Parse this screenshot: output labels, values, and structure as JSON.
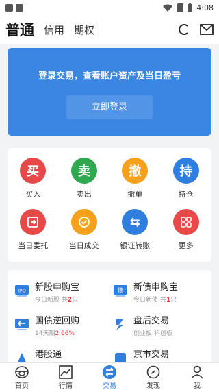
{
  "status": {
    "time": "4:08"
  },
  "nav": {
    "tabs": [
      "普通",
      "信用",
      "期权"
    ]
  },
  "banner": {
    "text": "登录交易，查看账户资产及当日盈亏",
    "login_button": "立即登录"
  },
  "actions": [
    {
      "glyph": "买",
      "label": "买入",
      "color": "#e84848"
    },
    {
      "glyph": "卖",
      "label": "卖出",
      "color": "#2fa84f"
    },
    {
      "glyph": "撤",
      "label": "撤单",
      "color": "#f7a11b"
    },
    {
      "glyph": "持",
      "label": "持仓",
      "color": "#2f7fe0"
    },
    {
      "glyph": "",
      "label": "当日委托",
      "color": "#e84848"
    },
    {
      "glyph": "",
      "label": "当日成交",
      "color": "#f7a11b"
    },
    {
      "glyph": "⇆",
      "label": "银证转账",
      "color": "#2f7fe0"
    },
    {
      "glyph": "",
      "label": "更多",
      "color": "#e84848"
    }
  ],
  "services": [
    {
      "title": "新股申购宝",
      "sub_pre": "今日新股 共",
      "sub_red": "2",
      "sub_post": "只",
      "icon": "ipo-icon"
    },
    {
      "title": "新债申购宝",
      "sub_pre": "今日新债 共",
      "sub_red": "1",
      "sub_post": "只",
      "icon": "bond-icon"
    },
    {
      "title": "国债逆回购",
      "sub_pre": "14天期",
      "sub_red": "2.66%",
      "sub_post": "",
      "icon": "repo-icon"
    },
    {
      "title": "盘后交易",
      "sub_pre": "创业板|科创板",
      "sub_red": "",
      "sub_post": "",
      "icon": "after-hours-icon"
    },
    {
      "title": "港股通",
      "sub_pre": "",
      "sub_red": "",
      "sub_post": "",
      "icon": "hk-stock-icon"
    },
    {
      "title": "京市交易",
      "sub_pre": "",
      "sub_red": "",
      "sub_post": "",
      "icon": "beijing-market-icon"
    }
  ],
  "bottom_nav": [
    {
      "label": "首页",
      "icon": "home-icon"
    },
    {
      "label": "行情",
      "icon": "chart-icon"
    },
    {
      "label": "交易",
      "icon": "trade-icon",
      "active": true
    },
    {
      "label": "发现",
      "icon": "compass-icon"
    },
    {
      "label": "我",
      "icon": "person-icon"
    }
  ],
  "colors": {
    "accent": "#2f7fe0",
    "banner": "#3b86e3",
    "red": "#e8333b"
  }
}
